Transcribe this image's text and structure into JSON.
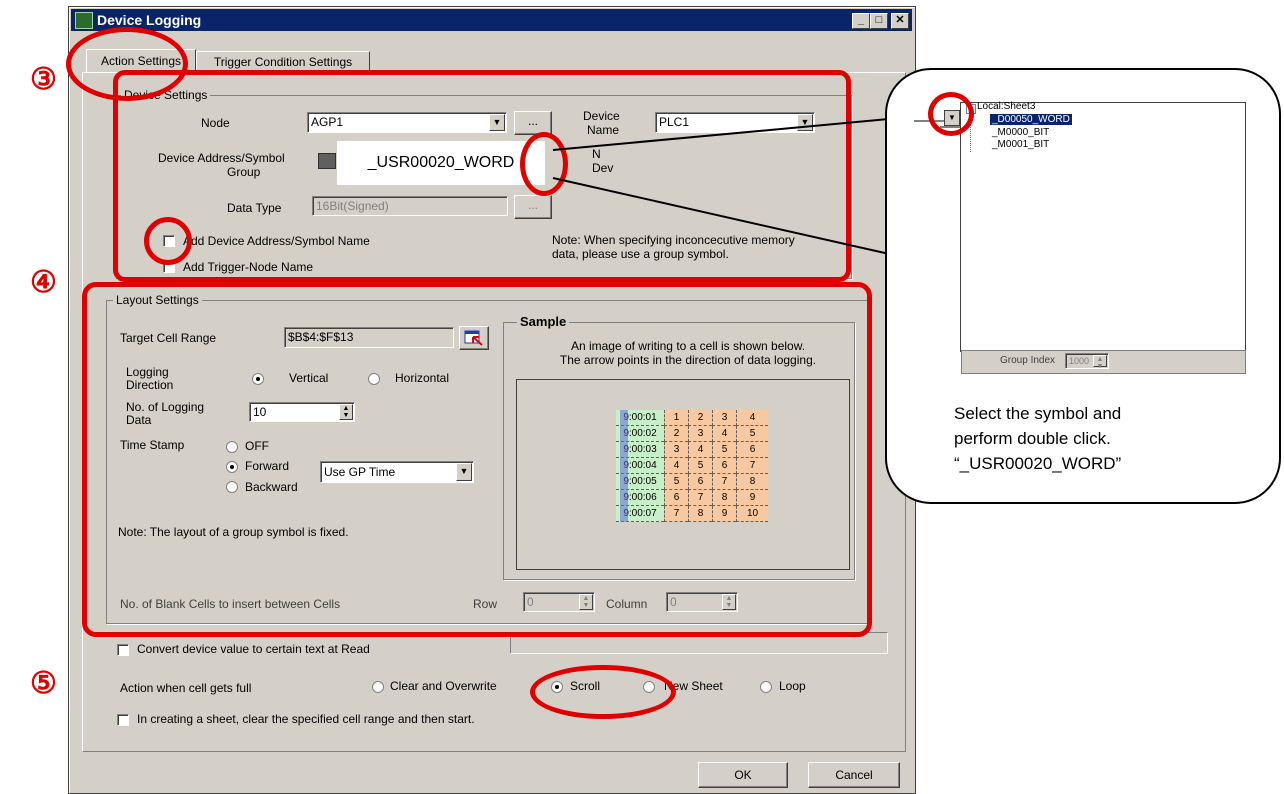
{
  "window": {
    "title": "Device Logging",
    "min_icon": "minimize-icon",
    "max_icon": "maximize-icon",
    "close_icon": "close-icon"
  },
  "tabs": [
    {
      "label": "Action Settings"
    },
    {
      "label": "Trigger Condition Settings"
    }
  ],
  "device_settings": {
    "legend": "Device Settings",
    "node_label": "Node",
    "node_value": "AGP1",
    "device_name_label_1": "Device",
    "device_name_label_2": "Name",
    "device_name_value": "PLC1",
    "address_label_1": "Device Address/Symbol",
    "address_label_2": "Group",
    "address_overlay": "_USR00020_WORD",
    "partial_label_1": "N",
    "partial_label_2": "Dev",
    "data_type_label": "Data Type",
    "data_type_value": "16Bit(Signed)",
    "browse_label": "...",
    "add_address_label": "Add Device Address/Symbol Name",
    "add_trigger_label": "Add Trigger-Node Name",
    "note": "Note: When specifying inconcecutive memory data, please use a group symbol."
  },
  "layout_settings": {
    "legend": "Layout Settings",
    "target_label": "Target Cell Range",
    "target_value": "$B$4:$F$13",
    "direction_label_1": "Logging",
    "direction_label_2": "Direction",
    "vertical": "Vertical",
    "horizontal": "Horizontal",
    "count_label_1": "No. of Logging",
    "count_label_2": "Data",
    "count_value": "10",
    "timestamp_label": "Time Stamp",
    "ts_off": "OFF",
    "ts_forward": "Forward",
    "ts_backward": "Backward",
    "time_source": "Use GP Time",
    "note": "Note: The layout of a group symbol is fixed.",
    "blank_label": "No. of Blank Cells to insert between Cells",
    "row_label": "Row",
    "row_value": "0",
    "column_label": "Column",
    "column_value": "0"
  },
  "sample": {
    "legend": "Sample",
    "text_1": "An image of writing to a cell is shown below.",
    "text_2": "The arrow points in the direction of data logging.",
    "rows": [
      [
        "9:00:01",
        "1",
        "2",
        "3",
        "4"
      ],
      [
        "9:00:02",
        "2",
        "3",
        "4",
        "5"
      ],
      [
        "9:00:03",
        "3",
        "4",
        "5",
        "6"
      ],
      [
        "9:00:04",
        "4",
        "5",
        "6",
        "7"
      ],
      [
        "9:00:05",
        "5",
        "6",
        "7",
        "8"
      ],
      [
        "9:00:06",
        "6",
        "7",
        "8",
        "9"
      ],
      [
        "9:00:07",
        "7",
        "8",
        "9",
        "10"
      ]
    ]
  },
  "options": {
    "convert_label": "Convert device value to certain text at Read",
    "action_label": "Action when cell gets full",
    "clear": "Clear and Overwrite",
    "scroll": "Scroll",
    "new_sheet": "New Sheet",
    "loop": "Loop",
    "clear_range_label": "In creating a sheet, clear the specified cell range and then start."
  },
  "buttons": {
    "ok": "OK",
    "cancel": "Cancel"
  },
  "markers": {
    "m3": "③",
    "m4": "④",
    "m5": "⑤"
  },
  "callout": {
    "tree_root": "Local:Sheet3",
    "tree_items": [
      "_D00050_WORD",
      "_M0000_BIT",
      "_M0001_BIT"
    ],
    "group_index_label": "Group Index",
    "group_index_value": "1000",
    "caption_1": "Select the symbol and",
    "caption_2": "perform double click.",
    "caption_3": "“_USR00020_WORD”"
  },
  "colors": {
    "annotation": "#e00000",
    "title_bar": "#0a246a",
    "dialog": "#d4d0c8",
    "sample_time": "#c8f0c8",
    "sample_values": "#f8c8a0"
  }
}
